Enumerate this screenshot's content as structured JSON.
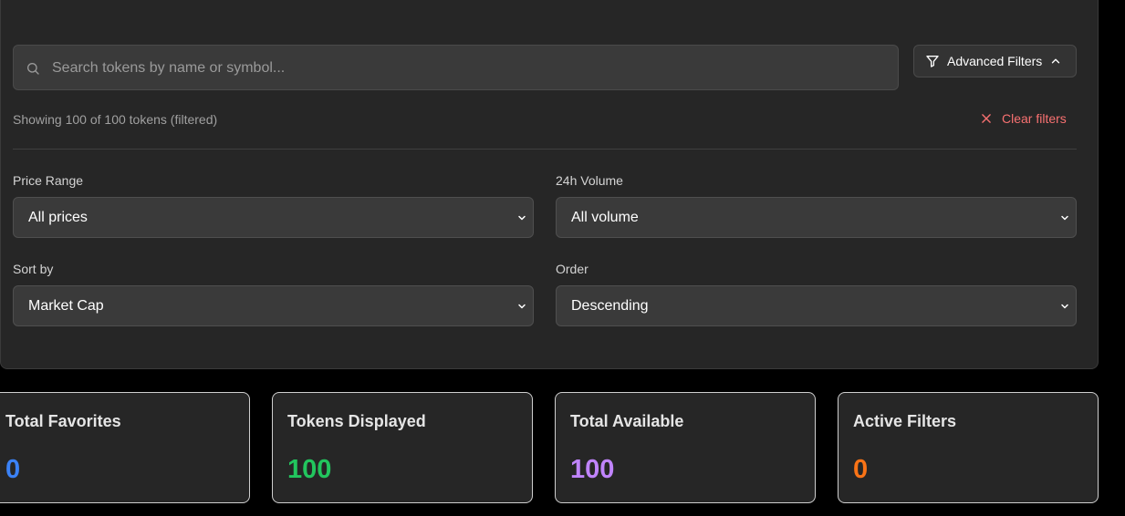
{
  "search": {
    "placeholder": "Search tokens by name or symbol...",
    "value": ""
  },
  "advanced_filters": {
    "label": "Advanced Filters"
  },
  "status": {
    "showing_text": "Showing 100 of 100 tokens (filtered)",
    "clear_label": "Clear filters"
  },
  "filters": {
    "price_range": {
      "label": "Price Range",
      "value": "All prices"
    },
    "volume": {
      "label": "24h Volume",
      "value": "All volume"
    },
    "sort_by": {
      "label": "Sort by",
      "value": "Market Cap"
    },
    "order": {
      "label": "Order",
      "value": "Descending"
    }
  },
  "stats": {
    "favorites": {
      "title": "Total Favorites",
      "value": "0",
      "color": "#3b82f6"
    },
    "displayed": {
      "title": "Tokens Displayed",
      "value": "100",
      "color": "#22c55e"
    },
    "available": {
      "title": "Total Available",
      "value": "100",
      "color": "#c084fc"
    },
    "active_filters": {
      "title": "Active Filters",
      "value": "0",
      "color": "#f97316"
    }
  },
  "colors": {
    "accent_red": "#f87171",
    "panel_bg": "#262626",
    "page_bg": "#000000"
  }
}
